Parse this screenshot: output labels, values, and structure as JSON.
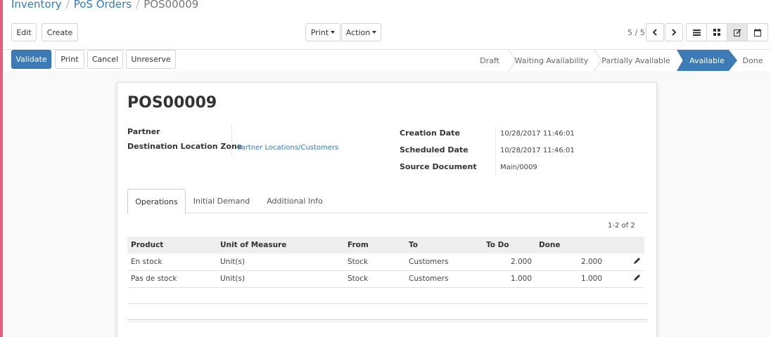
{
  "breadcrumb": {
    "root": "Inventory",
    "parent": "PoS Orders",
    "current": "POS00009"
  },
  "toolbar": {
    "edit": "Edit",
    "create": "Create",
    "print": "Print",
    "action": "Action"
  },
  "pager": {
    "text": "5 / 5"
  },
  "icons": {
    "prev": "chevron-left-icon",
    "next": "chevron-right-icon",
    "list": "list-view-icon",
    "kanban": "kanban-view-icon",
    "form": "form-view-icon",
    "calendar": "calendar-view-icon",
    "edit_row": "pencil-icon"
  },
  "actions": {
    "validate": "Validate",
    "print": "Print",
    "cancel": "Cancel",
    "unreserve": "Unreserve"
  },
  "status": {
    "stages": [
      "Draft",
      "Waiting Availability",
      "Partially Available",
      "Available",
      "Done"
    ],
    "active": "Available"
  },
  "record": {
    "name": "POS00009",
    "partner_label": "Partner",
    "partner_value": "",
    "dest_label": "Destination Location Zone",
    "dest_value": "Partner Locations/Customers",
    "creation_label": "Creation Date",
    "creation_value": "10/28/2017 11:46:01",
    "scheduled_label": "Scheduled Date",
    "scheduled_value": "10/28/2017 11:46:01",
    "source_label": "Source Document",
    "source_value": "Main/0009"
  },
  "tabs": [
    "Operations",
    "Initial Demand",
    "Additional Info"
  ],
  "table": {
    "count": "1-2 of 2",
    "headers": [
      "Product",
      "Unit of Measure",
      "From",
      "To",
      "To Do",
      "Done"
    ],
    "rows": [
      {
        "product": "En stock",
        "uom": "Unit(s)",
        "from": "Stock",
        "to": "Customers",
        "todo": "2.000",
        "done": "2.000"
      },
      {
        "product": "Pas de stock",
        "uom": "Unit(s)",
        "from": "Stock",
        "to": "Customers",
        "todo": "1.000",
        "done": "1.000"
      }
    ]
  },
  "colors": {
    "primary": "#3c7bb6",
    "link": "#337ab7",
    "left_accent": "#e0607e"
  }
}
